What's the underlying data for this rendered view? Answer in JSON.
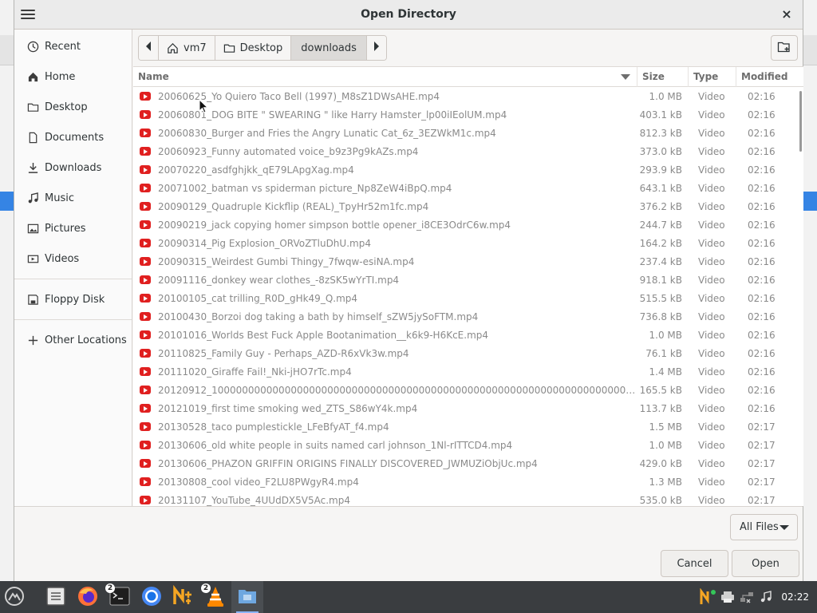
{
  "dialog": {
    "title": "Open Directory",
    "close_label": "×"
  },
  "sidebar": {
    "items": [
      {
        "label": "Recent",
        "icon": "clock-icon"
      },
      {
        "label": "Home",
        "icon": "home-icon"
      },
      {
        "label": "Desktop",
        "icon": "folder-icon"
      },
      {
        "label": "Documents",
        "icon": "document-icon"
      },
      {
        "label": "Downloads",
        "icon": "download-icon"
      },
      {
        "label": "Music",
        "icon": "music-icon"
      },
      {
        "label": "Pictures",
        "icon": "pictures-icon"
      },
      {
        "label": "Videos",
        "icon": "videos-icon"
      },
      {
        "label": "Floppy Disk",
        "icon": "floppy-icon"
      },
      {
        "label": "Other Locations",
        "icon": "plus-icon"
      }
    ]
  },
  "pathbar": {
    "segments": [
      "vm7",
      "Desktop",
      "downloads"
    ],
    "active_segment": "downloads"
  },
  "filelist": {
    "columns": {
      "name": "Name",
      "size": "Size",
      "type": "Type",
      "modified": "Modified"
    },
    "rows": [
      {
        "name": "20060625_Yo Quiero Taco Bell (1997)_M8sZ1DWsAHE.mp4",
        "size": "1.0 MB",
        "type": "Video",
        "modified": "02:16"
      },
      {
        "name": "20060801_DOG BITE \" SWEARING \" like Harry Hamster_lp00iIEolUM.mp4",
        "size": "403.1 kB",
        "type": "Video",
        "modified": "02:16"
      },
      {
        "name": "20060830_Burger and Fries the Angry Lunatic Cat_6z_3EZWkM1c.mp4",
        "size": "812.3 kB",
        "type": "Video",
        "modified": "02:16"
      },
      {
        "name": "20060923_Funny automated voice_b9z3Pg9kAZs.mp4",
        "size": "373.0 kB",
        "type": "Video",
        "modified": "02:16"
      },
      {
        "name": "20070220_asdfghjkk_qE79LApgXag.mp4",
        "size": "293.9 kB",
        "type": "Video",
        "modified": "02:16"
      },
      {
        "name": "20071002_batman vs spiderman picture_Np8ZeW4iBpQ.mp4",
        "size": "643.1 kB",
        "type": "Video",
        "modified": "02:16"
      },
      {
        "name": "20090129_Quadruple Kickflip (REAL)_TpyHr52m1fc.mp4",
        "size": "376.2 kB",
        "type": "Video",
        "modified": "02:16"
      },
      {
        "name": "20090219_jack copying homer simpson bottle opener_i8CE3OdrC6w.mp4",
        "size": "244.7 kB",
        "type": "Video",
        "modified": "02:16"
      },
      {
        "name": "20090314_Pig Explosion_ORVoZTluDhU.mp4",
        "size": "164.2 kB",
        "type": "Video",
        "modified": "02:16"
      },
      {
        "name": "20090315_Weirdest Gumbi Thingy_7fwqw-esiNA.mp4",
        "size": "237.4 kB",
        "type": "Video",
        "modified": "02:16"
      },
      {
        "name": "20091116_donkey wear clothes_-8zSK5wYrTI.mp4",
        "size": "918.1 kB",
        "type": "Video",
        "modified": "02:16"
      },
      {
        "name": "20100105_cat trilling_R0D_gHk49_Q.mp4",
        "size": "515.5 kB",
        "type": "Video",
        "modified": "02:16"
      },
      {
        "name": "20100430_Borzoi dog taking a bath by himself_sZW5jySoFTM.mp4",
        "size": "736.8 kB",
        "type": "Video",
        "modified": "02:16"
      },
      {
        "name": "20101016_Worlds Best Fuck Apple Bootanimation__k6k9-H6KcE.mp4",
        "size": "1.0 MB",
        "type": "Video",
        "modified": "02:16"
      },
      {
        "name": "20110825_Family Guy - Perhaps_AZD-R6xVk3w.mp4",
        "size": "76.1 kB",
        "type": "Video",
        "modified": "02:16"
      },
      {
        "name": "20111020_Giraffe Fail!_Nki-jHO7rTc.mp4",
        "size": "1.4 MB",
        "type": "Video",
        "modified": "02:16"
      },
      {
        "name": "20120912_10000000000000000000000000000000000000000000000000000000000000000000000000...",
        "size": "165.5 kB",
        "type": "Video",
        "modified": "02:16"
      },
      {
        "name": "20121019_first time smoking wed_ZTS_S86wY4k.mp4",
        "size": "113.7 kB",
        "type": "Video",
        "modified": "02:16"
      },
      {
        "name": "20130528_taco pumplestickle_LFeBfyAT_f4.mp4",
        "size": "1.5 MB",
        "type": "Video",
        "modified": "02:17"
      },
      {
        "name": "20130606_old white people in suits named carl johnson_1Nl-rITTCD4.mp4",
        "size": "1.0 MB",
        "type": "Video",
        "modified": "02:17"
      },
      {
        "name": "20130606_PHAZON GRIFFIN ORIGINS FINALLY DISCOVERED_JWMUZiObjUc.mp4",
        "size": "429.0 kB",
        "type": "Video",
        "modified": "02:17"
      },
      {
        "name": "20130808_cool video_F2LU8PWgyR4.mp4",
        "size": "1.3 MB",
        "type": "Video",
        "modified": "02:17"
      },
      {
        "name": "20131107_YouTube_4UUdDX5V5Ac.mp4",
        "size": "535.0 kB",
        "type": "Video",
        "modified": "02:17"
      }
    ]
  },
  "bottom": {
    "filter_label": "All Files",
    "cancel_label": "Cancel",
    "open_label": "Open"
  },
  "taskbar": {
    "apps": [
      {
        "name": "files",
        "icon": "file-manager-icon"
      },
      {
        "name": "firefox",
        "icon": "firefox-icon"
      },
      {
        "name": "terminal",
        "icon": "terminal-icon",
        "badge": "2"
      },
      {
        "name": "chromium",
        "icon": "chromium-icon"
      },
      {
        "name": "notepadqq",
        "icon": "notepadqq-icon"
      },
      {
        "name": "vlc",
        "icon": "vlc-icon",
        "badge": "2"
      },
      {
        "name": "file-chooser",
        "icon": "folder-app-icon"
      }
    ],
    "clock": "02:22"
  },
  "colors": {
    "video_icon": "#e02020",
    "taskbar_bg": "#3a3d40",
    "accent": "#3584e4"
  }
}
